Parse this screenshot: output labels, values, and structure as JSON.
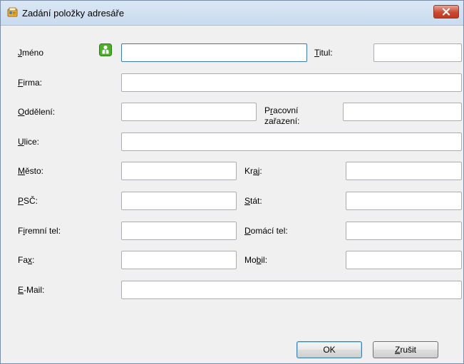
{
  "window": {
    "title": "Zadání položky adresáře"
  },
  "form": {
    "jmeno": {
      "label_u": "J",
      "label_rest": "méno",
      "value": ""
    },
    "titul": {
      "label_u": "T",
      "label_rest": "itul:",
      "value": ""
    },
    "firma": {
      "label_u": "F",
      "label_rest": "irma:",
      "value": ""
    },
    "oddeleni": {
      "label_u": "O",
      "label_rest": "ddělení:",
      "value": ""
    },
    "pracovni_zarazeni": {
      "label_pre": "P",
      "label_u": "r",
      "label_rest": "acovní zařazení:",
      "value": ""
    },
    "ulice": {
      "label_u": "U",
      "label_rest": "lice:",
      "value": ""
    },
    "mesto": {
      "label_u": "M",
      "label_rest": "ěsto:",
      "value": ""
    },
    "kraj": {
      "label_pre": "Kr",
      "label_u": "a",
      "label_rest": "j:",
      "value": ""
    },
    "psc": {
      "label_u": "P",
      "label_rest": "SČ:",
      "value": ""
    },
    "stat": {
      "label_u": "S",
      "label_rest": "tát:",
      "value": ""
    },
    "firemni_tel": {
      "label_pre": "F",
      "label_u": "i",
      "label_rest": "remní tel:",
      "value": ""
    },
    "domaci_tel": {
      "label_u": "D",
      "label_rest": "omácí tel:",
      "value": ""
    },
    "fax": {
      "label_pre": "Fa",
      "label_u": "x",
      "label_rest": ":",
      "value": ""
    },
    "mobil": {
      "label_pre": "Mo",
      "label_u": "b",
      "label_rest": "il:",
      "value": ""
    },
    "email": {
      "label_u": "E",
      "label_rest": "-Mail:",
      "value": ""
    }
  },
  "buttons": {
    "ok": "OK",
    "zrusit_u": "Z",
    "zrusit_rest": "rušit"
  },
  "icons": {
    "title": "address-book-icon",
    "contact": "person-icon",
    "close": "close-icon"
  },
  "colors": {
    "close_button": "#c94a31",
    "contact_icon": "#4caf2a",
    "default_button_border": "#3c7fb1"
  }
}
